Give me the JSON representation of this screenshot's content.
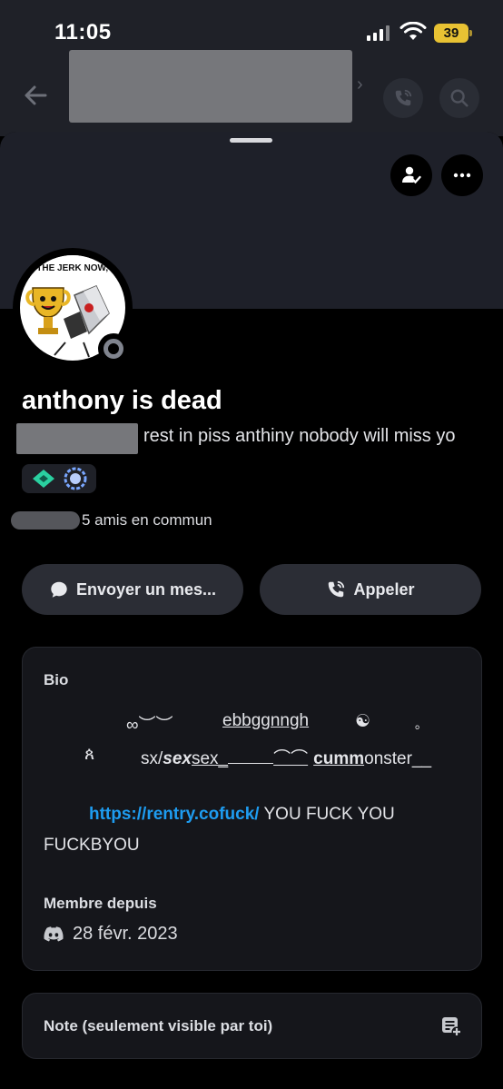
{
  "status_bar": {
    "time": "11:05",
    "battery": "39"
  },
  "profile": {
    "display_name": "anthony is dead",
    "status_text": "rest in piss anthiny nobody will miss yo",
    "mutual_friends": "5 amis en commun",
    "avatar_caption": "S THE JERK NOW, B"
  },
  "actions": {
    "message_label": "Envoyer un mes...",
    "call_label": "Appeler"
  },
  "bio": {
    "title": "Bio",
    "line1": [
      "∞︶︶",
      "ebbggnngh",
      "☯",
      "｡"
    ],
    "line2": [
      "ጰ",
      "sx/",
      "sex",
      "sex_",
      "⌒⌒",
      "cum",
      "m",
      "onster__"
    ],
    "link": "https://rentry.cofuck/",
    "after_link": " YOU FUCK YOU",
    "line4": "FUCKBYOU",
    "member_since_label": "Membre depuis",
    "member_since_date": "28 févr. 2023"
  },
  "note": {
    "label": "Note (seulement visible par toi)"
  },
  "colors": {
    "background": "#000000",
    "banner": "#1e2029",
    "card": "#15161b",
    "button": "#2b2d35",
    "link": "#1e9cf0",
    "battery": "#e8c233"
  },
  "icons": [
    "back-arrow-icon",
    "phone-call-icon",
    "search-icon",
    "friend-check-icon",
    "more-icon",
    "chat-bubble-icon",
    "discord-icon",
    "note-add-icon"
  ]
}
